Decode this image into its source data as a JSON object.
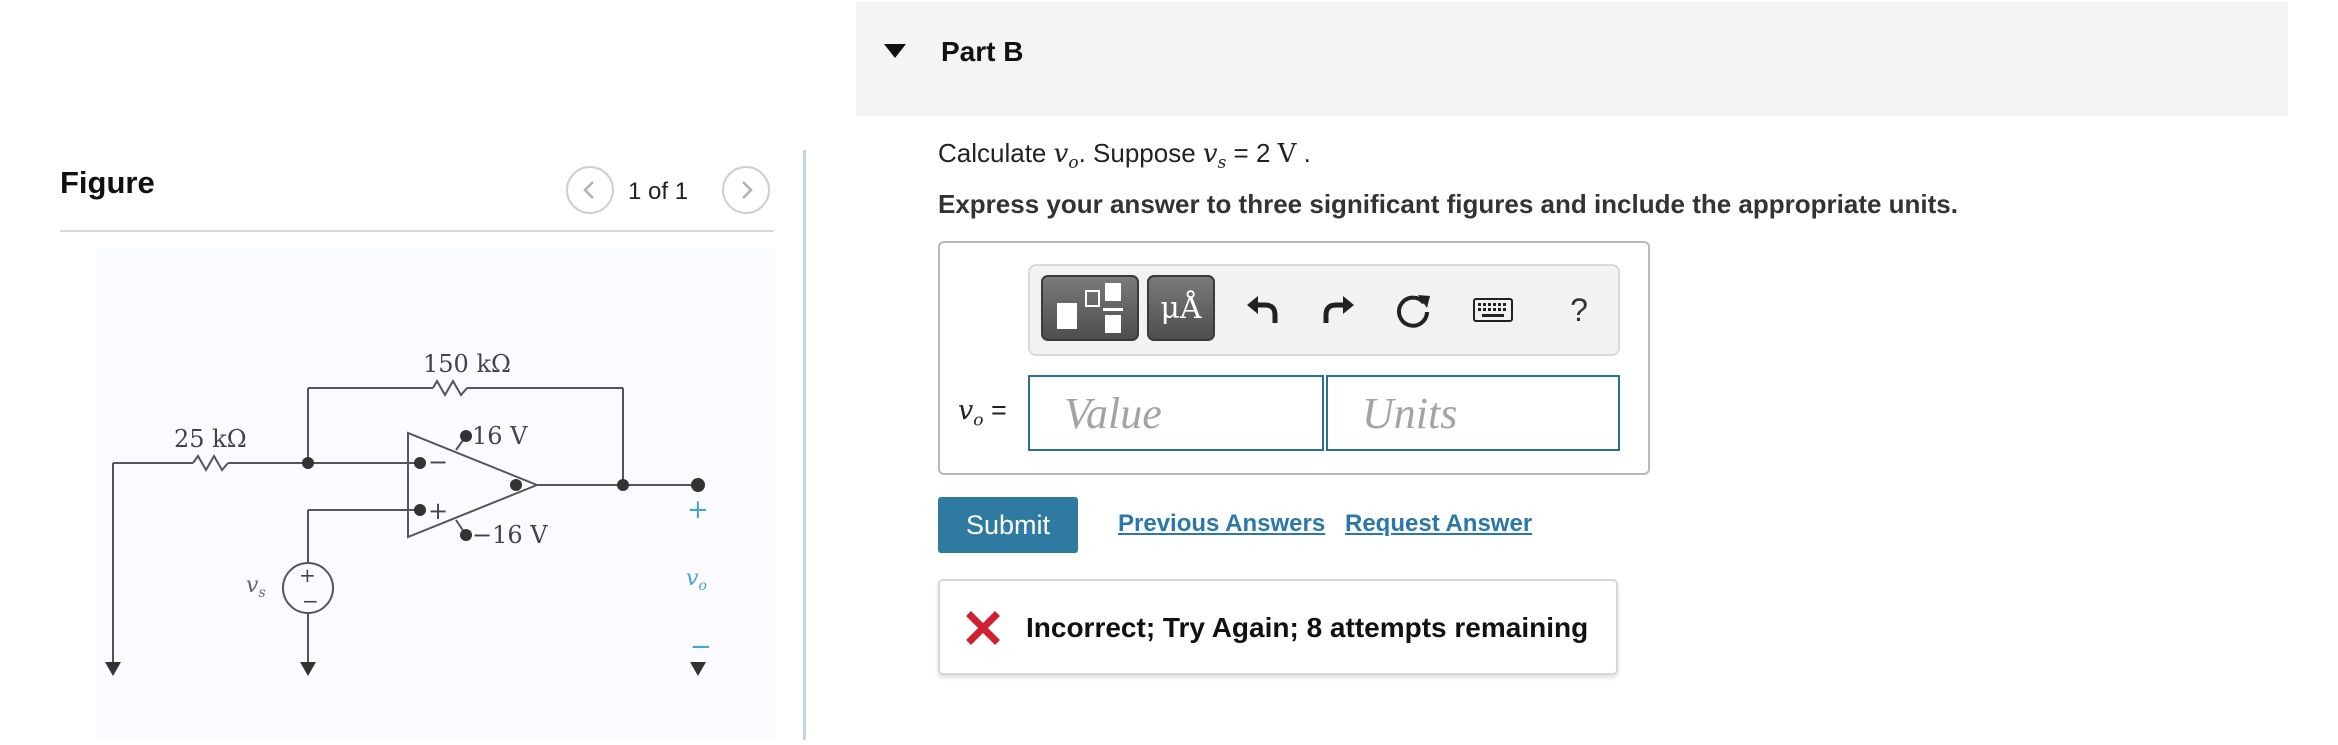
{
  "figure": {
    "title": "Figure",
    "page_counter": "1 of 1",
    "circuit": {
      "r1": "25 kΩ",
      "r2": "150 kΩ",
      "vpos": "16 V",
      "vneg": "−16 V",
      "minus_sign": "−",
      "plus_sign": "+",
      "source_symbol_plus": "+",
      "source_symbol_minus": "−",
      "vs_label": "v",
      "vs_sub": "s",
      "out_plus": "+",
      "out_minus": "−",
      "vo_label": "v",
      "vo_sub": "o"
    }
  },
  "part": {
    "title": "Part B",
    "question_prefix": "Calculate ",
    "question_var": "v",
    "question_var_sub": "o",
    "question_mid": ". Suppose ",
    "question_vs": "v",
    "question_vs_sub": "s",
    "question_eq": " = 2 ",
    "question_unit": "V",
    "question_end": " .",
    "instruction": "Express your answer to three significant figures and include the appropriate units."
  },
  "answer": {
    "label_var": "v",
    "label_sub": "o",
    "label_eq": " =",
    "value_placeholder": "Value",
    "units_placeholder": "Units",
    "value": "",
    "units": ""
  },
  "toolbar": {
    "units_label": "μÅ",
    "help_label": "?"
  },
  "actions": {
    "submit_label": "Submit",
    "previous_answers": "Previous Answers",
    "request_answer": "Request Answer"
  },
  "feedback": {
    "text": "Incorrect; Try Again; 8 attempts remaining",
    "color": "#d0202f"
  }
}
